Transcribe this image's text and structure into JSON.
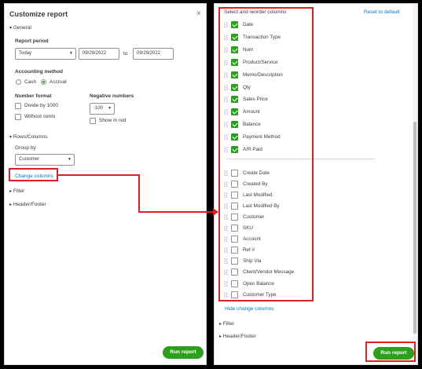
{
  "left": {
    "title": "Customize report",
    "close": "×",
    "general_label": "General",
    "report_period_label": "Report period",
    "period_value": "Today",
    "date_from": "09/29/2022",
    "to_label": "to",
    "date_to": "09/29/2022",
    "accounting_method_label": "Accounting method",
    "cash_label": "Cash",
    "accrual_label": "Accrual",
    "number_format_label": "Number format",
    "divide_label": "Divide by 1000",
    "without_cents_label": "Without cents",
    "negative_numbers_label": "Negative numbers",
    "negative_value": "-100",
    "show_in_red_label": "Show in red",
    "rows_columns_label": "Rows/Columns",
    "group_by_label": "Group by",
    "group_by_value": "Customer",
    "change_columns_link": "Change columns",
    "filter_label": "Filter",
    "header_footer_label": "Header/Footer",
    "run_report_label": "Run report"
  },
  "right": {
    "section_title": "Select and reorder columns",
    "reset_link": "Reset to default",
    "selected_columns": [
      "Date",
      "Transaction Type",
      "Num",
      "Product/Service",
      "Memo/Description",
      "Qty",
      "Sales Price",
      "Amount",
      "Balance",
      "Payment Method",
      "A/R Paid"
    ],
    "available_columns": [
      "Create Date",
      "Created By",
      "Last Modified",
      "Last Modified By",
      "Customer",
      "SKU",
      "Account",
      "Ref #",
      "Ship Via",
      "Client/Vendor Message",
      "Open Balance",
      "Customer Type"
    ],
    "hide_link": "Hide change columns",
    "filter_label": "Filter",
    "header_footer_label": "Header/Footer",
    "run_report_label": "Run report"
  },
  "colors": {
    "accent_green": "#2ca01c",
    "link_blue": "#0077c5",
    "annotation_red": "#e02020"
  }
}
